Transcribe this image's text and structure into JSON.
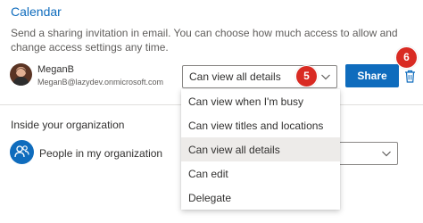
{
  "heading": "Calendar",
  "description": "Send a sharing invitation in email. You can choose how much access to allow and change access settings any time.",
  "user": {
    "name": "MeganB",
    "email": "MeganB@lazydev.onmicrosoft.com"
  },
  "permission_select": {
    "value": "Can view all details"
  },
  "badges": {
    "step5": "5",
    "step6": "6"
  },
  "share_button": "Share",
  "org_section": {
    "title": "Inside your organization",
    "label": "People in my organization"
  },
  "dropdown_options": [
    "Can view when I'm busy",
    "Can view titles and locations",
    "Can view all details",
    "Can edit",
    "Delegate"
  ],
  "selected_option": "Can view all details",
  "colors": {
    "accent": "#0f6cbd",
    "badge": "#d92b23",
    "selected_row": "#edebe9"
  },
  "icons": [
    "chevron-down-icon",
    "trash-icon",
    "people-icon",
    "avatar"
  ]
}
